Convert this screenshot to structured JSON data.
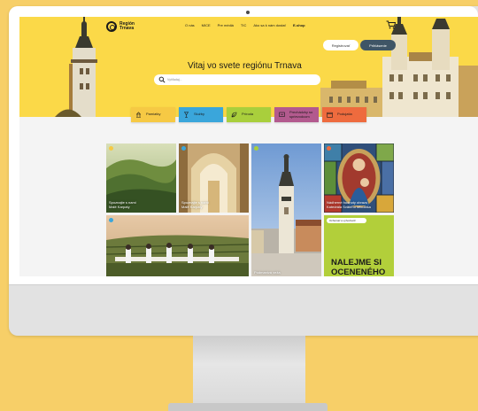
{
  "site": {
    "logo_line1": "Región",
    "logo_line2": "Trnava",
    "nav": [
      "O nás",
      "MICE",
      "Pre médiá",
      "TIC",
      "Ako sa k nám dostať",
      "E-shop"
    ],
    "register_label": "Registrovať",
    "login_label": "Prihlásenie",
    "hero_title": "Vitaj vo svete regiónu Trnava",
    "search_placeholder": "Vyhľadaj..."
  },
  "categories": [
    {
      "label": "Pamiatky",
      "color": "#f6c944",
      "icon": "monument-icon"
    },
    {
      "label": "Služby",
      "color": "#3aa6db",
      "icon": "glass-icon"
    },
    {
      "label": "Príroda",
      "color": "#a9cf3c",
      "icon": "leaf-icon"
    },
    {
      "label": "Prechádzky so sprievodcom",
      "color": "#b35a8e",
      "icon": "guide-icon"
    },
    {
      "label": "Podujatia",
      "color": "#ee6b3e",
      "icon": "calendar-icon"
    }
  ],
  "tiles": [
    {
      "caption_1": "Spoznajte s nami",
      "caption_2": "Malé Karpaty"
    },
    {
      "caption_1": "Spoznajte s nami",
      "caption_2": "Malé Karpaty"
    },
    {
      "caption_1": "Podmanivá veža",
      "caption_2": ""
    },
    {
      "caption_1": "Nádherné hodnoty obrazu",
      "caption_2": "Katedrála Svätého Mikuláša"
    }
  ],
  "promo": {
    "chip": "Ochutnať a vyhodnotiť",
    "line1": "NALEJME SI",
    "line2": "OCENENÉHO"
  },
  "colors": {
    "hero_yellow": "#fbd948",
    "page_background": "#f7cf68",
    "login_button": "#3f5566",
    "promo_green": "#b2cf3a"
  }
}
